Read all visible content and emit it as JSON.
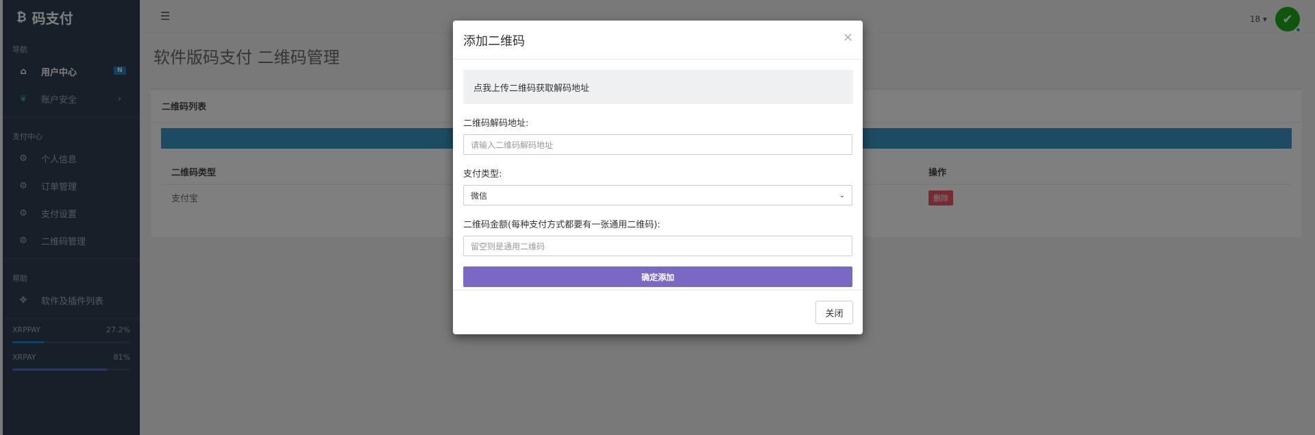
{
  "sidebar": {
    "brand": "码支付",
    "brand_icon": "bitcoin-icon",
    "sections": [
      {
        "header": "导航",
        "items": [
          {
            "label": "用户中心",
            "icon": "home-icon",
            "badge": "N",
            "active": true
          },
          {
            "label": "账户安全",
            "icon": "leaf-icon",
            "chevron": "›"
          }
        ]
      },
      {
        "header": "支付中心",
        "items": [
          {
            "label": "个人信息",
            "icon": "gear-icon"
          },
          {
            "label": "订单管理",
            "icon": "gear-icon"
          },
          {
            "label": "支付设置",
            "icon": "gear-icon"
          },
          {
            "label": "二维码管理",
            "icon": "gear-icon"
          }
        ]
      },
      {
        "header": "帮助",
        "items": [
          {
            "label": "软件及插件列表",
            "icon": "puzzle-icon"
          }
        ]
      }
    ],
    "progress": [
      {
        "name": "XRPPAY",
        "value": "27.2%",
        "fraction": 0.272
      },
      {
        "name": "XRPAY",
        "value": "81%",
        "fraction": 0.81
      }
    ]
  },
  "topbar": {
    "user_number": "18 ▾"
  },
  "page": {
    "title": "软件版码支付 二维码管理",
    "panel_title": "二维码列表",
    "table": {
      "headers": [
        "二维码类型",
        "操作"
      ],
      "rows": [
        [
          "支付宝",
          "删除"
        ]
      ]
    }
  },
  "modal": {
    "title": "添加二维码",
    "close_symbol": "×",
    "upload_text": "点我上传二维码获取解码地址",
    "decode_label": "二维码解码地址:",
    "decode_placeholder": "请输入二维码解码地址",
    "pay_type_label": "支付类型:",
    "pay_type_value": "微信",
    "amount_label": "二维码金额(每种支付方式都要有一张通用二维码):",
    "amount_placeholder": "留空则是通用二维码",
    "submit_label": "确定添加",
    "close_label": "关闭"
  },
  "colors": {
    "sidebar_bg": "#2f4050",
    "submit_bg": "#7b68c4",
    "info_bar": "#3a97c9",
    "delete_bg": "#ed5565"
  }
}
